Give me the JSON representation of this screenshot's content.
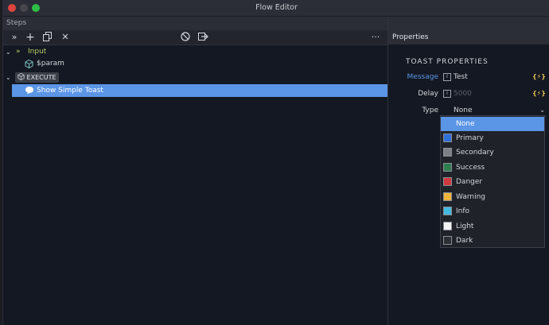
{
  "window": {
    "title": "Flow Editor"
  },
  "steps": {
    "header": "Steps",
    "toolbar": {
      "expand_icon": "»",
      "add_icon": "+",
      "copy_icon": "⧉",
      "delete_icon": "✕",
      "disable_icon": "⃠",
      "export_icon": "⇥",
      "more_icon": "···"
    },
    "tree": {
      "input_label": "Input",
      "param_label": "$param",
      "execute_label": "EXECUTE",
      "selected_step_label": "Show Simple Toast"
    }
  },
  "properties": {
    "header": "Properties",
    "section_title": "TOAST PROPERTIES",
    "message": {
      "label": "Message",
      "value": "Test"
    },
    "delay": {
      "label": "Delay",
      "placeholder": "5000"
    },
    "type": {
      "label": "Type",
      "value": "None"
    },
    "dynamic_icon": "{⚡}"
  },
  "type_dropdown": {
    "options": [
      {
        "label": "None",
        "color": "",
        "selected": true
      },
      {
        "label": "Primary",
        "color": "#2f6fd8"
      },
      {
        "label": "Secondary",
        "color": "#7d8085"
      },
      {
        "label": "Success",
        "color": "#2f7d4f"
      },
      {
        "label": "Danger",
        "color": "#d0393f"
      },
      {
        "label": "Warning",
        "color": "#f0b43c"
      },
      {
        "label": "Info",
        "color": "#45b8e0"
      },
      {
        "label": "Light",
        "color": "#f2f3f5"
      },
      {
        "label": "Dark",
        "color": "#2b2e33"
      }
    ]
  },
  "colors": {
    "accent": "#5b95e6",
    "message_label": "#5b95e6",
    "input_label": "#b7cf6a",
    "dynamic_icon": "#e8c15a"
  }
}
